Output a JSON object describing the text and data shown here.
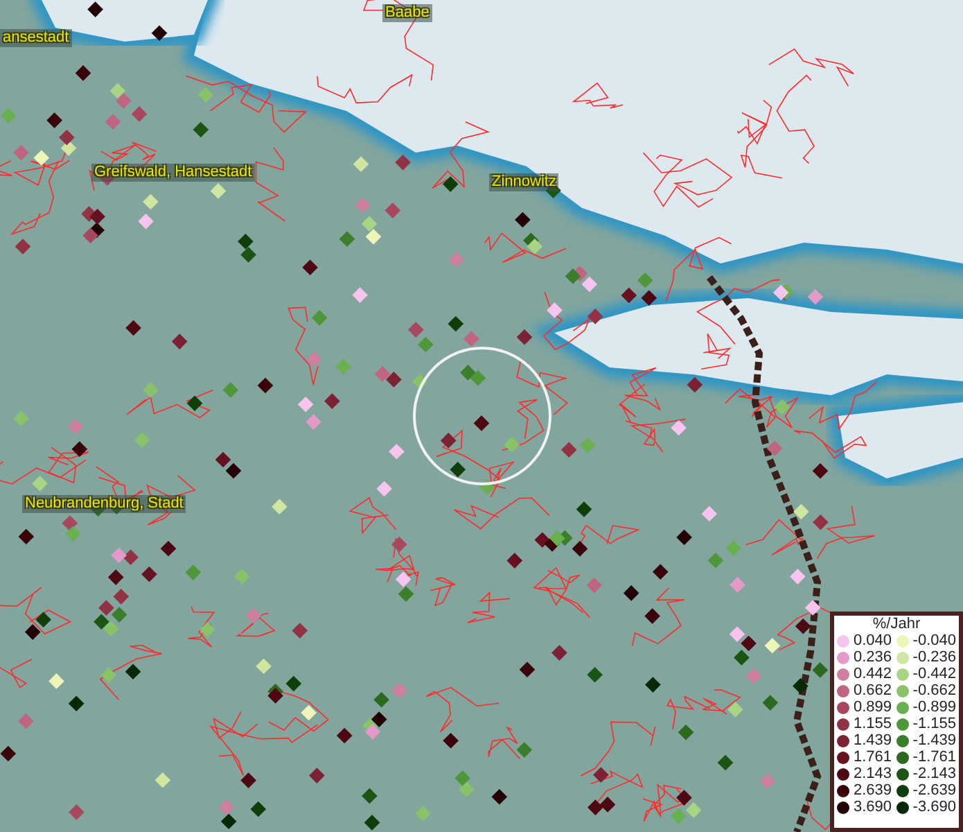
{
  "place_labels": [
    {
      "text": "ansestadt",
      "kind": "town"
    },
    {
      "text": "Baabe",
      "kind": "town"
    },
    {
      "text": "Greifswald, Hansestadt",
      "kind": "town"
    },
    {
      "text": "Zinnowitz",
      "kind": "town"
    },
    {
      "text": "Neubrandenburg, Stadt",
      "kind": "town"
    }
  ],
  "legend": {
    "title": "%/Jahr",
    "items": [
      {
        "label": "0.040",
        "color": "#f6c4ec"
      },
      {
        "label": "-0.040",
        "color": "#eef5b8"
      },
      {
        "label": "0.236",
        "color": "#e49ac8"
      },
      {
        "label": "-0.236",
        "color": "#cfe6a0"
      },
      {
        "label": "0.442",
        "color": "#cf7f9f"
      },
      {
        "label": "-0.442",
        "color": "#a8d483"
      },
      {
        "label": "0.662",
        "color": "#bf6580"
      },
      {
        "label": "-0.662",
        "color": "#88c36a"
      },
      {
        "label": "0.899",
        "color": "#a8485f"
      },
      {
        "label": "-0.899",
        "color": "#69b050"
      },
      {
        "label": "1.155",
        "color": "#923245"
      },
      {
        "label": "-1.155",
        "color": "#4e973a"
      },
      {
        "label": "1.439",
        "color": "#7d2235"
      },
      {
        "label": "-1.439",
        "color": "#3b7f2c"
      },
      {
        "label": "1.761",
        "color": "#66111f"
      },
      {
        "label": "-1.761",
        "color": "#2a6a1f"
      },
      {
        "label": "2.143",
        "color": "#4e0812"
      },
      {
        "label": "-2.143",
        "color": "#1b5513"
      },
      {
        "label": "2.639",
        "color": "#3a0309"
      },
      {
        "label": "-2.639",
        "color": "#0f3e0b"
      },
      {
        "label": "3.690",
        "color": "#230005"
      },
      {
        "label": "-3.690",
        "color": "#062805"
      }
    ]
  }
}
